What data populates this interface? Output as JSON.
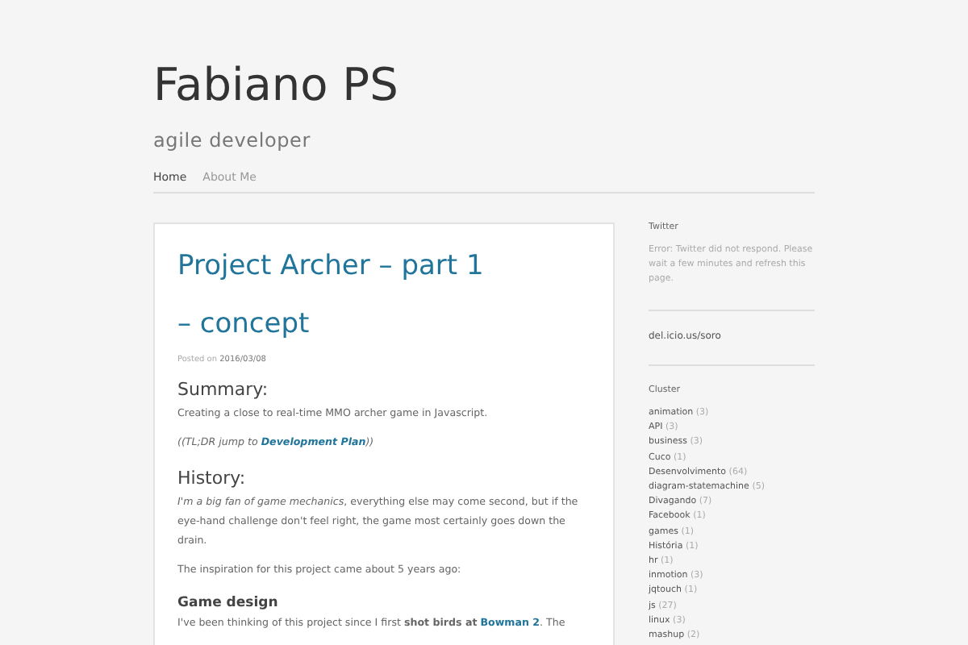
{
  "site": {
    "title": "Fabiano PS",
    "tagline": "agile developer"
  },
  "nav": [
    {
      "label": "Home",
      "selected": true
    },
    {
      "label": "About Me",
      "selected": false
    }
  ],
  "post": {
    "title": "Project Archer – part 1 – concept",
    "posted_label": "Posted on",
    "date": "2016/03/08",
    "blocks": [
      {
        "kind": "heading",
        "text": "Summary:"
      },
      {
        "kind": "paragraph",
        "parts": [
          {
            "kind": "text",
            "text": "Creating a close to real-time MMO archer game in Javascript."
          }
        ]
      },
      {
        "kind": "paragraph",
        "parts": [
          {
            "kind": "text",
            "text": "*((TL;DR jump to* "
          },
          {
            "kind": "link",
            "text": "Development Plan",
            "italic": true
          },
          {
            "kind": "text",
            "text": "*))*"
          }
        ]
      },
      {
        "kind": "heading",
        "text": "History:"
      },
      {
        "kind": "paragraph",
        "parts": [
          {
            "kind": "text",
            "text": "*I'm a big fan of game mechanics*, everything else may come second, but if the eye-hand challenge don't feel right, the game most certainly goes down the drain."
          }
        ]
      },
      {
        "kind": "paragraph",
        "parts": [
          {
            "kind": "text",
            "text": "The inspiration for this project came about 5 years ago:"
          }
        ]
      },
      {
        "kind": "subheading",
        "text": "Game design"
      },
      {
        "kind": "paragraph",
        "parts": [
          {
            "kind": "text",
            "text": "I've been thinking of this project since I first **shot birds at** "
          },
          {
            "kind": "link",
            "text": "Bowman 2",
            "italic": false
          },
          {
            "kind": "text",
            "text": ". The"
          }
        ]
      }
    ]
  },
  "sidebar": [
    {
      "kind": "text",
      "title": "Twitter",
      "text": "Error: Twitter did not respond. Please wait a few minutes and refresh this page."
    },
    {
      "kind": "link",
      "text": "del.icio.us/soro"
    },
    {
      "kind": "list",
      "title": "Cluster",
      "items": [
        {
          "label": "animation",
          "count": "(3)"
        },
        {
          "label": "API",
          "count": "(3)"
        },
        {
          "label": "business",
          "count": "(3)"
        },
        {
          "label": "Cuco",
          "count": "(1)"
        },
        {
          "label": "Desenvolvimento",
          "count": "(64)"
        },
        {
          "label": "diagram-statemachine",
          "count": "(5)"
        },
        {
          "label": "Divagando",
          "count": "(7)"
        },
        {
          "label": "Facebook",
          "count": "(1)"
        },
        {
          "label": "games",
          "count": "(1)"
        },
        {
          "label": "História",
          "count": "(1)"
        },
        {
          "label": "hr",
          "count": "(1)"
        },
        {
          "label": "inmotion",
          "count": "(3)"
        },
        {
          "label": "jqtouch",
          "count": "(1)"
        },
        {
          "label": "js",
          "count": "(27)"
        },
        {
          "label": "linux",
          "count": "(3)"
        },
        {
          "label": "mashup",
          "count": "(2)"
        }
      ]
    }
  ]
}
